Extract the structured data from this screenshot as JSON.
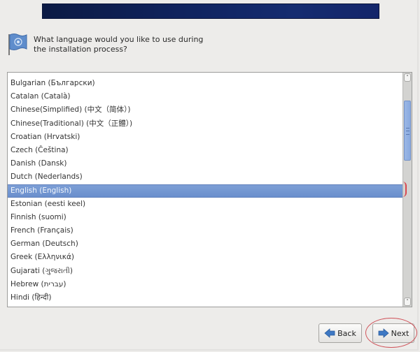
{
  "header": {
    "banner_color": "#102460"
  },
  "prompt": {
    "icon": "language-flag-icon",
    "text": "What language would you like to use during the installation process?"
  },
  "language_list": {
    "selected_index": 8,
    "items": [
      {
        "label": "Bulgarian (Български)"
      },
      {
        "label": "Catalan (Català)"
      },
      {
        "label": "Chinese(Simplified) (中文（简体）)"
      },
      {
        "label": "Chinese(Traditional) (中文（正體）)"
      },
      {
        "label": "Croatian (Hrvatski)"
      },
      {
        "label": "Czech (Čeština)"
      },
      {
        "label": "Danish (Dansk)"
      },
      {
        "label": "Dutch (Nederlands)"
      },
      {
        "label": "English (English)"
      },
      {
        "label": "Estonian (eesti keel)"
      },
      {
        "label": "Finnish (suomi)"
      },
      {
        "label": "French (Français)"
      },
      {
        "label": "German (Deutsch)"
      },
      {
        "label": "Greek (Ελληνικά)"
      },
      {
        "label": "Gujarati (ગુજરાતી)"
      },
      {
        "label": "Hebrew (עברית)"
      },
      {
        "label": "Hindi (हिन्दी)"
      }
    ],
    "selection_color": "#7397d3"
  },
  "scrollbar": {
    "up_glyph": "˄",
    "down_glyph": "˅"
  },
  "buttons": {
    "back_label": "Back",
    "next_label": "Next"
  },
  "annotation": {
    "highlight_color": "#d0545b"
  }
}
